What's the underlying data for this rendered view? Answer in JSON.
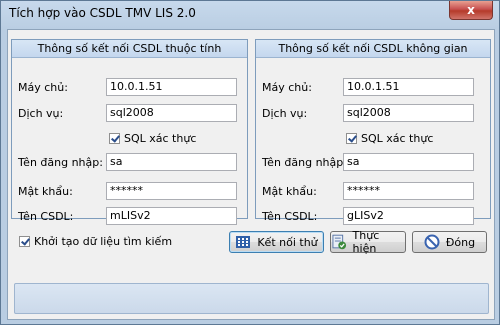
{
  "window": {
    "title": "Tích hợp vào CSDL TMV LIS 2.0",
    "close_label": "x"
  },
  "left_group": {
    "header": "Thông số kết nối CSDL thuộc tính",
    "server_label": "Máy chủ:",
    "server_value": "10.0.1.51",
    "service_label": "Dịch vụ:",
    "service_value": "sql2008",
    "sql_auth_label": "SQL xác thực",
    "sql_auth_checked": true,
    "username_label": "Tên đăng nhập:",
    "username_value": "sa",
    "password_label": "Mật khẩu:",
    "password_value": "******",
    "db_label": "Tên CSDL:",
    "db_value": "mLISv2"
  },
  "right_group": {
    "header": "Thông số kết nối CSDL không gian",
    "server_label": "Máy chủ:",
    "server_value": "10.0.1.51",
    "service_label": "Dịch vụ:",
    "service_value": "sql2008",
    "sql_auth_label": "SQL xác thực",
    "sql_auth_checked": true,
    "username_label": "Tên đăng nhập:",
    "username_value": "sa",
    "password_label": "Mật khẩu:",
    "password_value": "******",
    "db_label": "Tên CSDL:",
    "db_value": "gLISv2"
  },
  "init_search_label": "Khởi tạo dữ liệu tìm kiếm",
  "init_search_checked": true,
  "buttons": {
    "test": {
      "label": "Kết nối thử",
      "icon": "grid-connect-icon"
    },
    "run": {
      "label": "Thực hiện",
      "icon": "run-check-icon"
    },
    "close": {
      "label": "Đóng",
      "icon": "no-entry-icon"
    }
  },
  "colors": {
    "title_bg": "#b9cde2",
    "close_button": "#c75050",
    "group_header": "#c4d7ee"
  }
}
